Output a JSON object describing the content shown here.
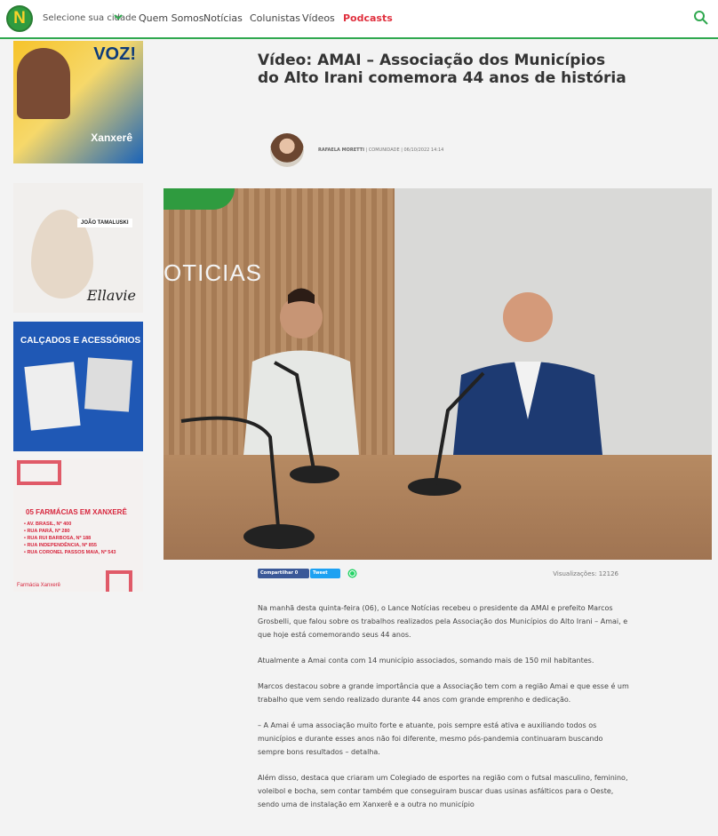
{
  "header": {
    "logo_letter": "N",
    "city_label": "Selecione sua cidade",
    "nav": [
      "Quem Somos",
      "Notícias",
      "Colunistas",
      "Vídeos",
      "Podcasts"
    ]
  },
  "ads": {
    "ad1": {
      "headline": "VOZ!",
      "city": "Xanxerê"
    },
    "ad2": {
      "name": "JOÃO TAMALUSKI",
      "brand": "Ellavie"
    },
    "ad3": {
      "title": "CALÇADOS E ACESSÓRIOS"
    },
    "ad4": {
      "title": "05 FARMÁCIAS EM XANXERÊ",
      "addresses": [
        "• AV. BRASIL, Nº 400",
        "• RUA PARÁ, Nº 280",
        "• RUA RUI BARBOSA, Nº 188",
        "• RUA INDEPENDÊNCIA, Nº 855",
        "• RUA CORONEL PASSOS MAIA, Nº 543"
      ],
      "logo_text": "Farmácia Xanxerê"
    }
  },
  "article": {
    "title": "Vídeo: AMAI – Associação dos Municípios do Alto Irani comemora 44 anos de história",
    "author": "RAFAELA MORETTI",
    "category": "COMUNIDADE",
    "datetime": "06/10/2022 14:14",
    "hero_wall_text": "OTICIAS",
    "share": {
      "facebook": "Compartilhar 0",
      "twitter": "Tweet"
    },
    "views": "Visualizações: 12126",
    "paragraphs": [
      "Na manhã desta quinta-feira (06), o Lance Notícias recebeu o presidente da AMAI e prefeito Marcos Grosbelli, que falou sobre os trabalhos realizados pela Associação dos Municípios do Alto Irani – Amai, e que hoje está comemorando seus 44 anos.",
      "Atualmente a Amai conta com 14 município associados, somando mais de 150 mil habitantes.",
      "Marcos destacou sobre a grande importância que a Associação tem com a região Amai e que esse é um trabalho que vem sendo realizado durante 44 anos com grande emprenho e dedicação.",
      "– A Amai é uma associação muito forte e atuante, pois sempre está ativa e auxiliando todos os municípios e durante esses anos não foi diferente, mesmo pós-pandemia continuaram buscando sempre bons resultados – detalha.",
      "Além disso, destaca que criaram um Colegiado de esportes na região com o futsal masculino, feminino, voleibol e bocha, sem contar também que conseguiram buscar duas usinas asfálticos para o Oeste, sendo uma de instalação em Xanxerê e a outra no município"
    ]
  },
  "colors": {
    "brand_green": "#2fa84f",
    "podcast_red": "#e0303e",
    "facebook": "#3b5998",
    "twitter": "#1da1f2",
    "whatsapp": "#25d366"
  }
}
